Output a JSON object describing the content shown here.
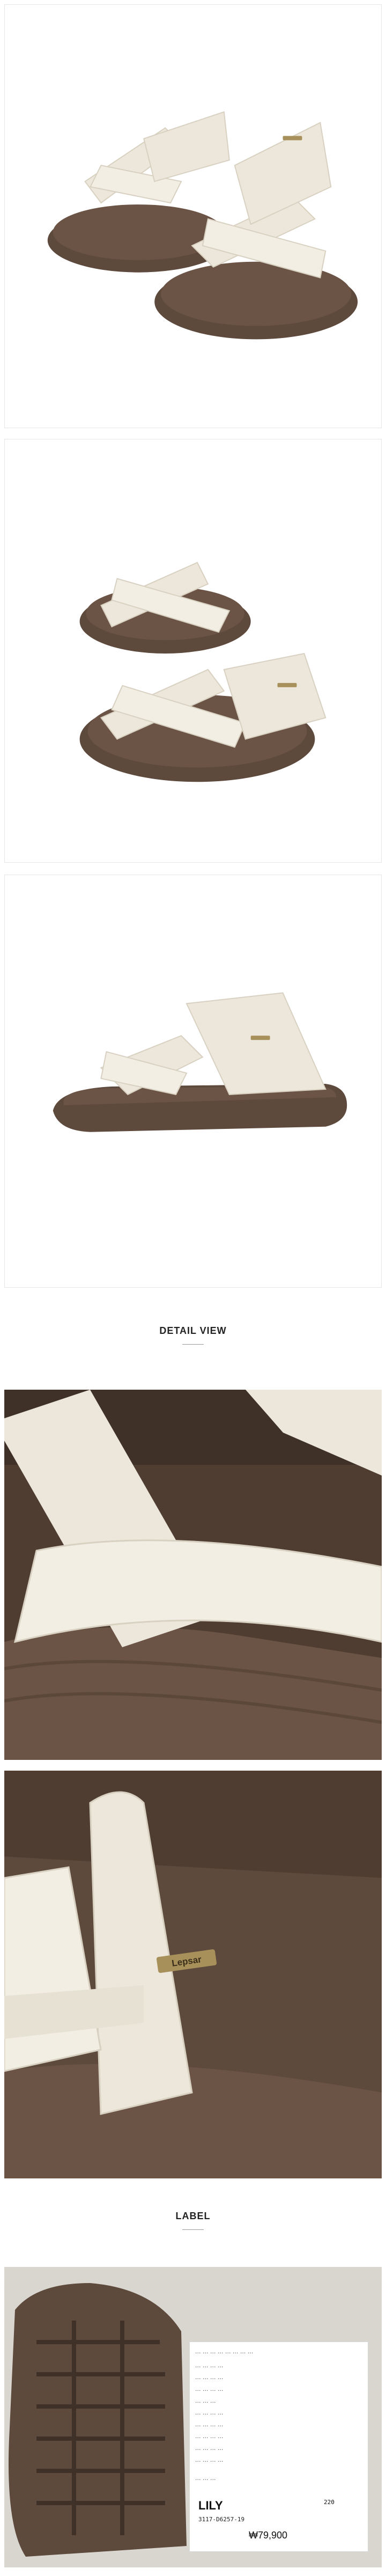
{
  "sections": {
    "detail_view": "DETAIL VIEW",
    "label": "LABEL"
  },
  "product": {
    "logo_text": "Lepsar"
  },
  "tag": {
    "model": "LILY",
    "code": "3117-D6257-19",
    "size": "220",
    "price": "₩79,900"
  },
  "colors": {
    "strap": "#ece7da",
    "sole": "#5e4a3d",
    "footbed": "#6b5445"
  }
}
